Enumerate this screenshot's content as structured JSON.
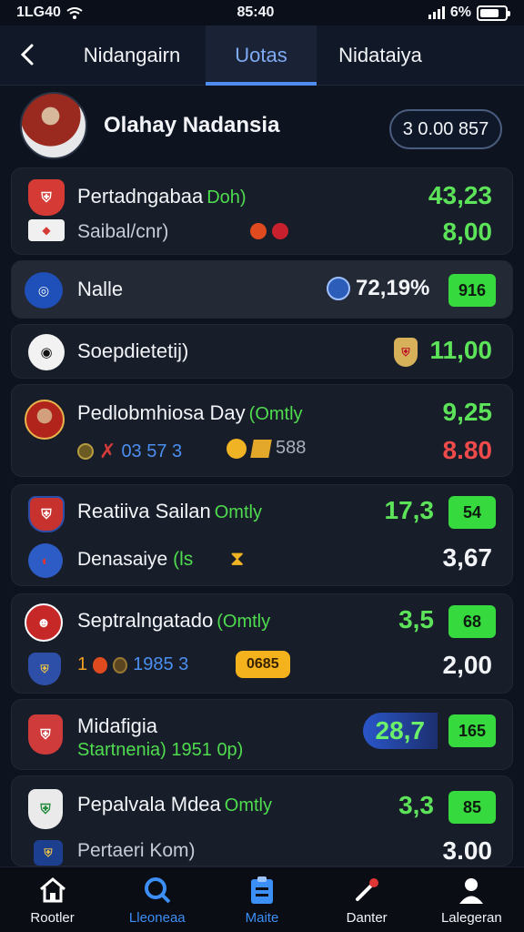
{
  "status_bar": {
    "carrier": "1LG40",
    "time": "85:40",
    "battery": "6%"
  },
  "nav": {
    "tabs": [
      {
        "label": "Nidangairn"
      },
      {
        "label": "Uotas"
      },
      {
        "label": "Nidataiya"
      }
    ]
  },
  "profile": {
    "name": "Olahay Nadansia",
    "badge": "3 0.00 857"
  },
  "cards": [
    {
      "label": "Pertadngabaa",
      "sub": "Doh)",
      "sub_label": "Saibal/cnr)",
      "value1": "43,23",
      "value2": "8,00"
    },
    {
      "label": "Nalle",
      "percent": "72,19%",
      "pill": "916"
    },
    {
      "label": "Soepdietetij)",
      "value1": "11,00"
    },
    {
      "label": "Pedlobmhiosa Day",
      "sub": "(Omtly",
      "inline_text": "03 57 3",
      "inline_text2": "588",
      "value1": "9,25",
      "value2": "8.80"
    },
    {
      "label": "Reatiiva Sailan",
      "sub": "Omtly",
      "sub_label": "Denasaiye",
      "sub_suffix": "(ls",
      "value1": "17,3",
      "pill": "54",
      "value2": "3,67"
    },
    {
      "label": "Septralngatado",
      "sub": "(Omtly",
      "inline_text": "1",
      "inline_text2": "1985 3",
      "chip": "0685",
      "value1": "3,5",
      "pill": "68",
      "value2": "2,00"
    },
    {
      "label": "Midafigia",
      "sub_label": "Startnenia) 1951 0p)",
      "value1": "28,7",
      "pill": "165"
    },
    {
      "label": "Pepalvala Mdea",
      "sub": "Omtly",
      "sub_label": "Pertaeri Kom)",
      "value1": "3,3",
      "pill": "85",
      "value2": "3.00"
    }
  ],
  "bottom_nav": [
    {
      "label": "Rootler"
    },
    {
      "label": "Lleoneaa"
    },
    {
      "label": "Maite"
    },
    {
      "label": "Danter"
    },
    {
      "label": "Lalegeran"
    }
  ],
  "colors": {
    "accent_blue": "#4f8df3",
    "positive": "#5de359",
    "negative": "#ef4b4b",
    "pill": "#36d93e"
  },
  "icons": [
    "back-icon",
    "wifi-icon",
    "battery-icon",
    "home-icon",
    "search-icon",
    "clipboard-icon",
    "pen-icon",
    "profile-icon"
  ]
}
